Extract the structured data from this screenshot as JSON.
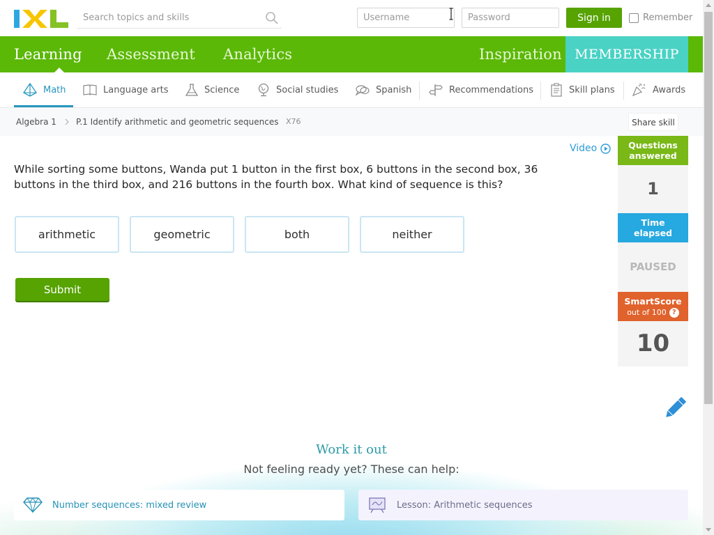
{
  "header": {
    "logo_text": "IXL",
    "search_placeholder": "Search topics and skills",
    "username_placeholder": "Username",
    "password_placeholder": "Password",
    "signin_label": "Sign in",
    "remember_label": "Remember"
  },
  "main_nav": {
    "items": [
      {
        "label": "Learning",
        "active": true
      },
      {
        "label": "Assessment"
      },
      {
        "label": "Analytics"
      },
      {
        "label": "Inspiration"
      }
    ],
    "membership_label": "MEMBERSHIP"
  },
  "subject_nav": {
    "items": [
      {
        "label": "Math",
        "icon": "pyramid-icon",
        "active": true
      },
      {
        "label": "Language arts",
        "icon": "book-icon"
      },
      {
        "label": "Science",
        "icon": "flask-icon"
      },
      {
        "label": "Social studies",
        "icon": "globe-icon"
      },
      {
        "label": "Spanish",
        "icon": "speech-icon"
      },
      {
        "label": "Recommendations",
        "icon": "signpost-icon"
      },
      {
        "label": "Skill plans",
        "icon": "clipboard-icon"
      },
      {
        "label": "Awards",
        "icon": "confetti-icon"
      }
    ]
  },
  "breadcrumb": {
    "course": "Algebra 1",
    "skill": "P.1 Identify arithmetic and geometric sequences",
    "code": "X76",
    "share_label": "Share skill"
  },
  "question": {
    "video_label": "Video",
    "text": "While sorting some buttons, Wanda put 1 button in the first box, 6 buttons in the second box, 36 buttons in the third box, and 216 buttons in the fourth box. What kind of sequence is this?",
    "choices": [
      "arithmetic",
      "geometric",
      "both",
      "neither"
    ],
    "submit_label": "Submit"
  },
  "stats": {
    "questions_label_1": "Questions",
    "questions_label_2": "answered",
    "questions_value": "1",
    "time_label_1": "Time",
    "time_label_2": "elapsed",
    "time_value": "PAUSED",
    "smartscore_label": "SmartScore",
    "smartscore_sub": "out of 100",
    "smartscore_value": "10"
  },
  "work_it_out": {
    "title": "Work it out",
    "subtitle": "Not feeling ready yet? These can help:",
    "cards": [
      {
        "label": "Number sequences: mixed review",
        "icon": "diamond-icon"
      },
      {
        "label": "Lesson: Arithmetic sequences",
        "icon": "lesson-board-icon"
      }
    ]
  },
  "colors": {
    "brand_green": "#5bb807",
    "membership_teal": "#4ad2c4",
    "accent_blue": "#2596be",
    "submit_green": "#56a301",
    "smartscore_orange": "#e0622c",
    "time_blue": "#26a8e0",
    "questions_green": "#79b817"
  }
}
